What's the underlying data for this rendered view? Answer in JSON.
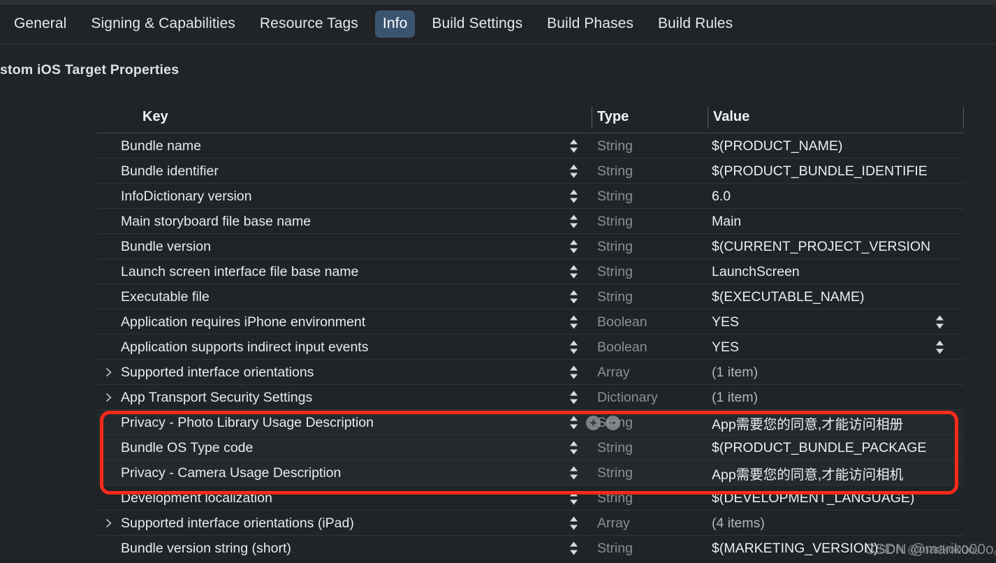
{
  "tabs": [
    {
      "label": "General",
      "active": false
    },
    {
      "label": "Signing & Capabilities",
      "active": false
    },
    {
      "label": "Resource Tags",
      "active": false
    },
    {
      "label": "Info",
      "active": true
    },
    {
      "label": "Build Settings",
      "active": false
    },
    {
      "label": "Build Phases",
      "active": false
    },
    {
      "label": "Build Rules",
      "active": false
    }
  ],
  "section": {
    "title": "stom iOS Target Properties"
  },
  "table": {
    "columns": {
      "key": "Key",
      "type": "Type",
      "value": "Value"
    },
    "rows": [
      {
        "key": "Bundle name",
        "type": "String",
        "value": "$(PRODUCT_NAME)",
        "disclosure": false,
        "key_stepper": true,
        "value_stepper": false,
        "plusminus": false,
        "highlighted": false,
        "value_muted": false
      },
      {
        "key": "Bundle identifier",
        "type": "String",
        "value": "$(PRODUCT_BUNDLE_IDENTIFIE",
        "disclosure": false,
        "key_stepper": true,
        "value_stepper": false,
        "plusminus": false,
        "highlighted": false,
        "value_muted": false
      },
      {
        "key": "InfoDictionary version",
        "type": "String",
        "value": "6.0",
        "disclosure": false,
        "key_stepper": true,
        "value_stepper": false,
        "plusminus": false,
        "highlighted": false,
        "value_muted": false
      },
      {
        "key": "Main storyboard file base name",
        "type": "String",
        "value": "Main",
        "disclosure": false,
        "key_stepper": true,
        "value_stepper": false,
        "plusminus": false,
        "highlighted": false,
        "value_muted": false
      },
      {
        "key": "Bundle version",
        "type": "String",
        "value": "$(CURRENT_PROJECT_VERSION",
        "disclosure": false,
        "key_stepper": true,
        "value_stepper": false,
        "plusminus": false,
        "highlighted": false,
        "value_muted": false
      },
      {
        "key": "Launch screen interface file base name",
        "type": "String",
        "value": "LaunchScreen",
        "disclosure": false,
        "key_stepper": true,
        "value_stepper": false,
        "plusminus": false,
        "highlighted": false,
        "value_muted": false
      },
      {
        "key": "Executable file",
        "type": "String",
        "value": "$(EXECUTABLE_NAME)",
        "disclosure": false,
        "key_stepper": true,
        "value_stepper": false,
        "plusminus": false,
        "highlighted": false,
        "value_muted": false
      },
      {
        "key": "Application requires iPhone environment",
        "type": "Boolean",
        "value": "YES",
        "disclosure": false,
        "key_stepper": true,
        "value_stepper": true,
        "plusminus": false,
        "highlighted": false,
        "value_muted": false
      },
      {
        "key": "Application supports indirect input events",
        "type": "Boolean",
        "value": "YES",
        "disclosure": false,
        "key_stepper": true,
        "value_stepper": true,
        "plusminus": false,
        "highlighted": false,
        "value_muted": false
      },
      {
        "key": "Supported interface orientations",
        "type": "Array",
        "value": "(1 item)",
        "disclosure": true,
        "key_stepper": true,
        "value_stepper": false,
        "plusminus": false,
        "highlighted": false,
        "value_muted": true
      },
      {
        "key": "App Transport Security Settings",
        "type": "Dictionary",
        "value": "(1 item)",
        "disclosure": true,
        "key_stepper": true,
        "value_stepper": false,
        "plusminus": false,
        "highlighted": false,
        "value_muted": true
      },
      {
        "key": "Privacy - Photo Library Usage Description",
        "type": "String",
        "value": "App需要您的同意,才能访问相册",
        "disclosure": false,
        "key_stepper": true,
        "value_stepper": false,
        "plusminus": true,
        "highlighted": true,
        "value_muted": false
      },
      {
        "key": "Bundle OS Type code",
        "type": "String",
        "value": "$(PRODUCT_BUNDLE_PACKAGE",
        "disclosure": false,
        "key_stepper": true,
        "value_stepper": false,
        "plusminus": false,
        "highlighted": true,
        "value_muted": false
      },
      {
        "key": "Privacy - Camera Usage Description",
        "type": "String",
        "value": "App需要您的同意,才能访问相机",
        "disclosure": false,
        "key_stepper": true,
        "value_stepper": false,
        "plusminus": false,
        "highlighted": true,
        "value_muted": false
      },
      {
        "key": "Development localization",
        "type": "String",
        "value": "$(DEVELOPMENT_LANGUAGE)",
        "disclosure": false,
        "key_stepper": true,
        "value_stepper": false,
        "plusminus": false,
        "highlighted": false,
        "value_muted": false
      },
      {
        "key": "Supported interface orientations (iPad)",
        "type": "Array",
        "value": "(4 items)",
        "disclosure": true,
        "key_stepper": true,
        "value_stepper": false,
        "plusminus": false,
        "highlighted": false,
        "value_muted": true
      },
      {
        "key": "Bundle version string (short)",
        "type": "String",
        "value": "$(MARKETING_VERSION)",
        "disclosure": false,
        "key_stepper": true,
        "value_stepper": false,
        "plusminus": false,
        "highlighted": false,
        "value_muted": false
      }
    ]
  },
  "annotation": {
    "color": "#fc2a1c"
  },
  "watermark": {
    "text": "CSDN @mariko00o。"
  },
  "icons": {
    "disclosure": "›",
    "plus": "+",
    "minus": "−"
  }
}
